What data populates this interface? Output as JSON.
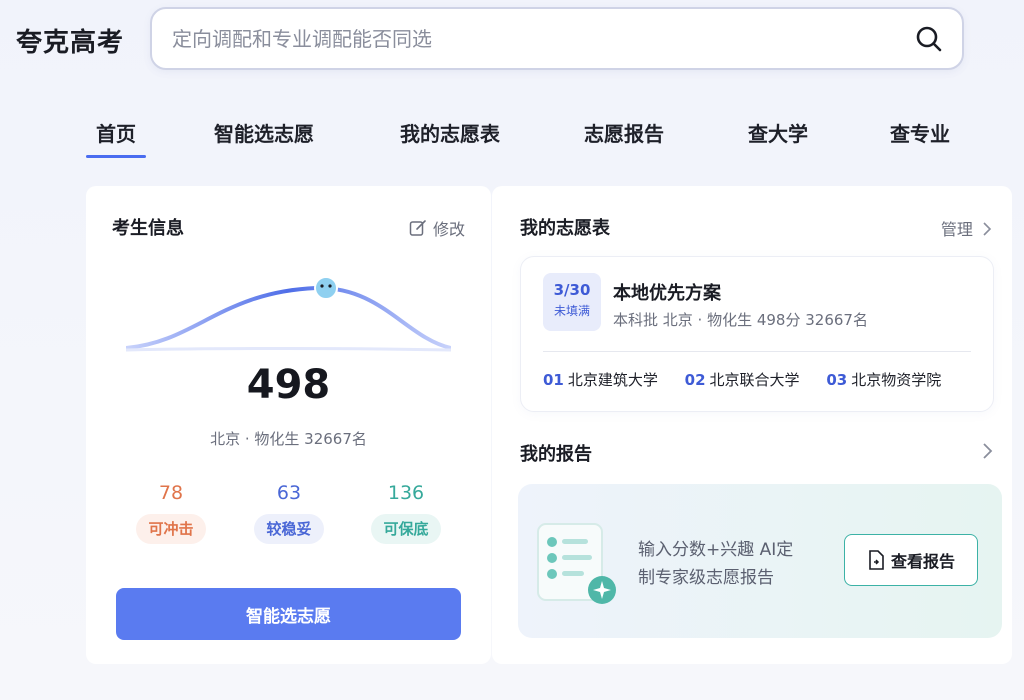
{
  "brand": "夸克高考",
  "search": {
    "placeholder": "定向调配和专业调配能否同选"
  },
  "nav": [
    {
      "label": "首页",
      "active": true
    },
    {
      "label": "智能选志愿"
    },
    {
      "label": "我的志愿表"
    },
    {
      "label": "志愿报告"
    },
    {
      "label": "查大学"
    },
    {
      "label": "查专业"
    }
  ],
  "student": {
    "title": "考生信息",
    "edit": "修改",
    "score": "498",
    "meta": "北京 · 物化生 32667名",
    "stats": [
      {
        "value": "78",
        "label": "可冲击",
        "color": "#e0744a",
        "bg": "#fdf0eb"
      },
      {
        "value": "63",
        "label": "较稳妥",
        "color": "#4a67d6",
        "bg": "#edf0fb"
      },
      {
        "value": "136",
        "label": "可保底",
        "color": "#36a99b",
        "bg": "#e9f6f4"
      }
    ],
    "cta": "智能选志愿"
  },
  "plan": {
    "title": "我的志愿表",
    "manage": "管理",
    "fraction": "3/30",
    "status": "未填满",
    "name": "本地优先方案",
    "desc": "本科批 北京 · 物化生 498分 32667名",
    "schools": [
      {
        "no": "01",
        "name": "北京建筑大学"
      },
      {
        "no": "02",
        "name": "北京联合大学"
      },
      {
        "no": "03",
        "name": "北京物资学院"
      }
    ]
  },
  "report": {
    "title": "我的报告",
    "line1": "输入分数+兴趣 AI定",
    "line2": "制专家级志愿报告",
    "button": "查看报告"
  }
}
